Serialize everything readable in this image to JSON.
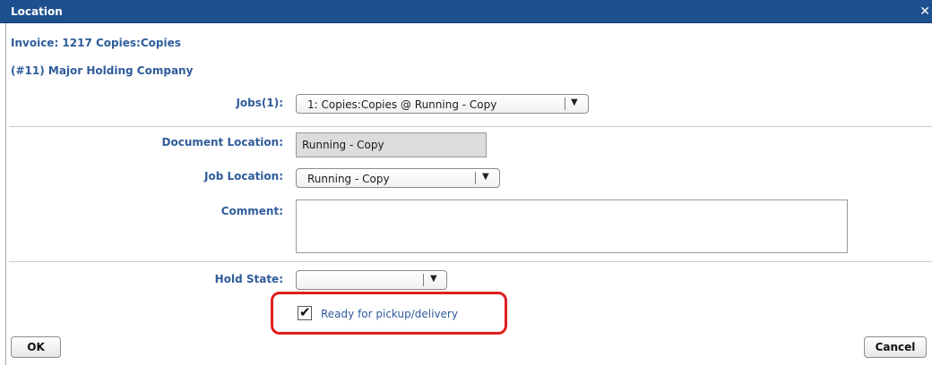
{
  "window": {
    "title": "Location",
    "close_glyph": "✕"
  },
  "header": {
    "invoice": "Invoice: 1217 Copies:Copies",
    "company": "(#11) Major Holding Company"
  },
  "jobs": {
    "label": "Jobs(1):",
    "selected": "1: Copies:Copies @ Running - Copy"
  },
  "document_location": {
    "label": "Document Location:",
    "value": "Running - Copy"
  },
  "job_location": {
    "label": "Job Location:",
    "selected": "Running - Copy"
  },
  "comment": {
    "label": "Comment:",
    "value": ""
  },
  "hold_state": {
    "label": "Hold State:",
    "selected": ""
  },
  "ready_checkbox": {
    "label": "Ready for pickup/delivery",
    "checked": true,
    "check_glyph": "✔"
  },
  "buttons": {
    "ok": "OK",
    "cancel": "Cancel"
  },
  "icons": {
    "dropdown": "▼"
  },
  "colors": {
    "titlebar": "#1e4f8f",
    "label_text": "#2f5c9b",
    "highlight": "#e01e1e"
  }
}
